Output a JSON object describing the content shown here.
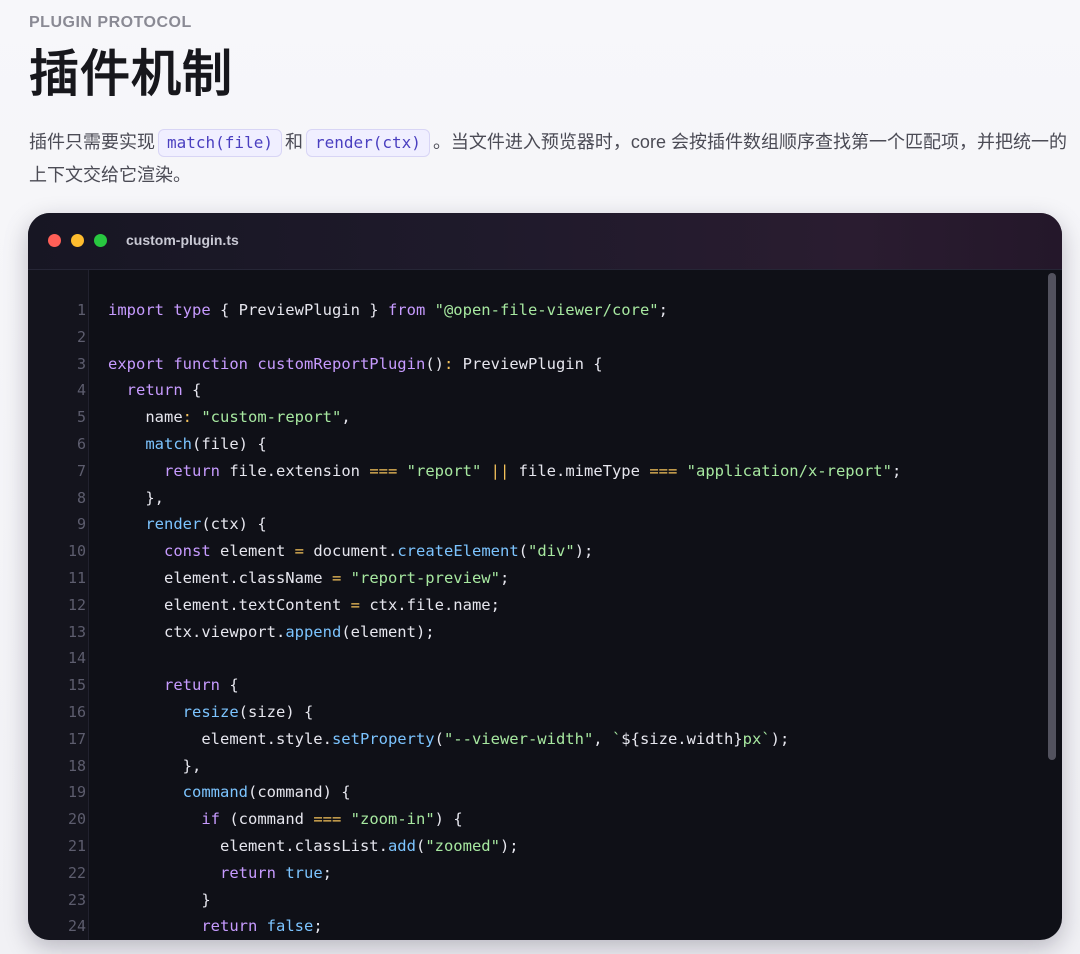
{
  "header": {
    "eyebrow": "PLUGIN PROTOCOL",
    "title": "插件机制",
    "desc_part1": "插件只需要实现",
    "desc_code1": "match(file)",
    "desc_part2": "和",
    "desc_code2": "render(ctx)",
    "desc_part3": "。当文件进入预览器时，core 会按插件数组顺序查找第一个匹配项，并把统一的上下文交给它渲染。"
  },
  "editor": {
    "filename": "custom-plugin.ts",
    "colors": {
      "keyword": "#c79bff",
      "function": "#7cc4ff",
      "string": "#a7e8a0",
      "operator": "#f3c15a",
      "plain": "#e6e6ee",
      "background": "#0f1017"
    },
    "lines": [
      {
        "n": "1",
        "tokens": [
          {
            "t": "kw",
            "v": "import type"
          },
          {
            "t": "pl",
            "v": " { PreviewPlugin } "
          },
          {
            "t": "kw",
            "v": "from"
          },
          {
            "t": "pl",
            "v": " "
          },
          {
            "t": "str",
            "v": "\"@open-file-viewer/core\""
          },
          {
            "t": "pl",
            "v": ";"
          }
        ]
      },
      {
        "n": "2",
        "tokens": []
      },
      {
        "n": "3",
        "tokens": [
          {
            "t": "kw",
            "v": "export function"
          },
          {
            "t": "pl",
            "v": " "
          },
          {
            "t": "kw",
            "v": "customReportPlugin"
          },
          {
            "t": "pl",
            "v": "()"
          },
          {
            "t": "op",
            "v": ":"
          },
          {
            "t": "pl",
            "v": " PreviewPlugin {"
          }
        ]
      },
      {
        "n": "4",
        "tokens": [
          {
            "t": "pl",
            "v": "  "
          },
          {
            "t": "kw",
            "v": "return"
          },
          {
            "t": "pl",
            "v": " {"
          }
        ]
      },
      {
        "n": "5",
        "tokens": [
          {
            "t": "pl",
            "v": "    name"
          },
          {
            "t": "op",
            "v": ":"
          },
          {
            "t": "pl",
            "v": " "
          },
          {
            "t": "str",
            "v": "\"custom-report\""
          },
          {
            "t": "pl",
            "v": ","
          }
        ]
      },
      {
        "n": "6",
        "tokens": [
          {
            "t": "pl",
            "v": "    "
          },
          {
            "t": "fn",
            "v": "match"
          },
          {
            "t": "pl",
            "v": "(file) {"
          }
        ]
      },
      {
        "n": "7",
        "tokens": [
          {
            "t": "pl",
            "v": "      "
          },
          {
            "t": "kw",
            "v": "return"
          },
          {
            "t": "pl",
            "v": " file.extension "
          },
          {
            "t": "op",
            "v": "==="
          },
          {
            "t": "pl",
            "v": " "
          },
          {
            "t": "str",
            "v": "\"report\""
          },
          {
            "t": "pl",
            "v": " "
          },
          {
            "t": "op",
            "v": "||"
          },
          {
            "t": "pl",
            "v": " file.mimeType "
          },
          {
            "t": "op",
            "v": "==="
          },
          {
            "t": "pl",
            "v": " "
          },
          {
            "t": "str",
            "v": "\"application/x-report\""
          },
          {
            "t": "pl",
            "v": ";"
          }
        ]
      },
      {
        "n": "8",
        "tokens": [
          {
            "t": "pl",
            "v": "    },"
          }
        ]
      },
      {
        "n": "9",
        "tokens": [
          {
            "t": "pl",
            "v": "    "
          },
          {
            "t": "fn",
            "v": "render"
          },
          {
            "t": "pl",
            "v": "(ctx) {"
          }
        ]
      },
      {
        "n": "10",
        "tokens": [
          {
            "t": "pl",
            "v": "      "
          },
          {
            "t": "kw",
            "v": "const"
          },
          {
            "t": "pl",
            "v": " element "
          },
          {
            "t": "op",
            "v": "="
          },
          {
            "t": "pl",
            "v": " document."
          },
          {
            "t": "fn",
            "v": "createElement"
          },
          {
            "t": "pl",
            "v": "("
          },
          {
            "t": "str",
            "v": "\"div\""
          },
          {
            "t": "pl",
            "v": ");"
          }
        ]
      },
      {
        "n": "11",
        "tokens": [
          {
            "t": "pl",
            "v": "      element.className "
          },
          {
            "t": "op",
            "v": "="
          },
          {
            "t": "pl",
            "v": " "
          },
          {
            "t": "str",
            "v": "\"report-preview\""
          },
          {
            "t": "pl",
            "v": ";"
          }
        ]
      },
      {
        "n": "12",
        "tokens": [
          {
            "t": "pl",
            "v": "      element.textContent "
          },
          {
            "t": "op",
            "v": "="
          },
          {
            "t": "pl",
            "v": " ctx.file.name;"
          }
        ]
      },
      {
        "n": "13",
        "tokens": [
          {
            "t": "pl",
            "v": "      ctx.viewport."
          },
          {
            "t": "fn",
            "v": "append"
          },
          {
            "t": "pl",
            "v": "(element);"
          }
        ]
      },
      {
        "n": "14",
        "tokens": []
      },
      {
        "n": "15",
        "tokens": [
          {
            "t": "pl",
            "v": "      "
          },
          {
            "t": "kw",
            "v": "return"
          },
          {
            "t": "pl",
            "v": " {"
          }
        ]
      },
      {
        "n": "16",
        "tokens": [
          {
            "t": "pl",
            "v": "        "
          },
          {
            "t": "fn",
            "v": "resize"
          },
          {
            "t": "pl",
            "v": "(size) {"
          }
        ]
      },
      {
        "n": "17",
        "tokens": [
          {
            "t": "pl",
            "v": "          element.style."
          },
          {
            "t": "fn",
            "v": "setProperty"
          },
          {
            "t": "pl",
            "v": "("
          },
          {
            "t": "str",
            "v": "\"--viewer-width\""
          },
          {
            "t": "pl",
            "v": ", "
          },
          {
            "t": "str",
            "v": "`"
          },
          {
            "t": "pl",
            "v": "${size.width}"
          },
          {
            "t": "str",
            "v": "px`"
          },
          {
            "t": "pl",
            "v": ");"
          }
        ]
      },
      {
        "n": "18",
        "tokens": [
          {
            "t": "pl",
            "v": "        },"
          }
        ]
      },
      {
        "n": "19",
        "tokens": [
          {
            "t": "pl",
            "v": "        "
          },
          {
            "t": "fn",
            "v": "command"
          },
          {
            "t": "pl",
            "v": "(command) {"
          }
        ]
      },
      {
        "n": "20",
        "tokens": [
          {
            "t": "pl",
            "v": "          "
          },
          {
            "t": "kw",
            "v": "if"
          },
          {
            "t": "pl",
            "v": " (command "
          },
          {
            "t": "op",
            "v": "==="
          },
          {
            "t": "pl",
            "v": " "
          },
          {
            "t": "str",
            "v": "\"zoom-in\""
          },
          {
            "t": "pl",
            "v": ") {"
          }
        ]
      },
      {
        "n": "21",
        "tokens": [
          {
            "t": "pl",
            "v": "            element.classList."
          },
          {
            "t": "fn",
            "v": "add"
          },
          {
            "t": "pl",
            "v": "("
          },
          {
            "t": "str",
            "v": "\"zoomed\""
          },
          {
            "t": "pl",
            "v": ");"
          }
        ]
      },
      {
        "n": "22",
        "tokens": [
          {
            "t": "pl",
            "v": "            "
          },
          {
            "t": "kw",
            "v": "return"
          },
          {
            "t": "pl",
            "v": " "
          },
          {
            "t": "fn",
            "v": "true"
          },
          {
            "t": "pl",
            "v": ";"
          }
        ]
      },
      {
        "n": "23",
        "tokens": [
          {
            "t": "pl",
            "v": "          }"
          }
        ]
      },
      {
        "n": "24",
        "tokens": [
          {
            "t": "pl",
            "v": "          "
          },
          {
            "t": "kw",
            "v": "return"
          },
          {
            "t": "pl",
            "v": " "
          },
          {
            "t": "fn",
            "v": "false"
          },
          {
            "t": "pl",
            "v": ";"
          }
        ]
      }
    ]
  }
}
